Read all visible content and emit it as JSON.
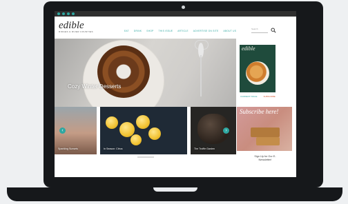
{
  "utility_bar": {
    "social_icons": [
      "twitter-icon",
      "facebook-icon",
      "instagram-icon",
      "pinterest-icon"
    ],
    "links": [
      "",
      "",
      "",
      ""
    ]
  },
  "header": {
    "logo_word": "edible",
    "logo_sub": "RIDGES & RIVER COUNTIES"
  },
  "nav": {
    "items": [
      "EAT",
      "DRINK",
      "SHOP",
      "THIS ISSUE",
      "ARTICLE",
      "ADVERTISE ON SITE",
      "ABOUT US"
    ]
  },
  "search": {
    "placeholder": "Search"
  },
  "hero": {
    "caption": "Cozy Winter Desserts"
  },
  "magazine": {
    "title": "edible",
    "link_a": "CURRENT ISSUE",
    "link_b": "SUBSCRIBE"
  },
  "carousel": {
    "tiles": [
      {
        "caption": "Sparkling Sunsets"
      },
      {
        "caption": "In Season: Citrus"
      },
      {
        "caption": "The Truffle Garden"
      }
    ]
  },
  "subscribe": {
    "art_script": "Subscribe here!",
    "line1": "Sign Up for Our E-",
    "line2": "Newsletter!",
    "small": ""
  },
  "colors": {
    "accent": "#2ea7a1",
    "accent_alt": "#d35a35",
    "frame": "#16181b"
  }
}
